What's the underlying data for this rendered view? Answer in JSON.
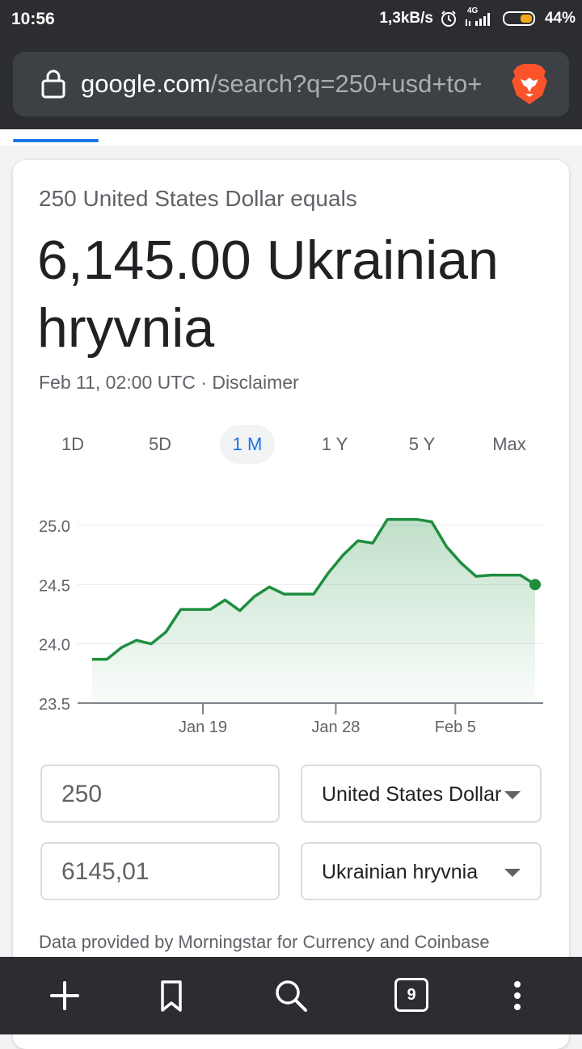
{
  "status_bar": {
    "time": "10:56",
    "network_speed": "1,3kB/s",
    "network_type": "4G",
    "battery": "44%",
    "icons": [
      "alarm-icon",
      "signal-icon",
      "battery-icon"
    ]
  },
  "browser": {
    "url_domain": "google.com",
    "url_path": "/search?q=250+usd+to+",
    "icons": [
      "lock-icon",
      "brave-lion-icon"
    ]
  },
  "converter": {
    "equals_label": "250 United States Dollar equals",
    "result": "6,145.00 Ukrainian hryvnia",
    "timestamp": "Feb 11, 02:00 UTC · Disclaimer",
    "ranges": [
      "1D",
      "5D",
      "1 M",
      "1 Y",
      "5 Y",
      "Max"
    ],
    "active_range": "1 M",
    "from_amount": "250",
    "from_currency": "United States Dollar",
    "to_amount": "6145,01",
    "to_currency": "Ukrainian hryvnia",
    "provider_text": "Data provided by Morningstar for Currency and Coinbase"
  },
  "chart_data": {
    "type": "area",
    "x_ticks": [
      "Jan 19",
      "Jan 28",
      "Feb 5"
    ],
    "y_ticks": [
      "25.0",
      "24.5",
      "24.0",
      "23.5"
    ],
    "ylim": [
      23.5,
      25.0
    ],
    "grid": true,
    "values": [
      23.87,
      23.87,
      23.97,
      24.03,
      24.0,
      24.1,
      24.29,
      24.29,
      24.29,
      24.37,
      24.28,
      24.4,
      24.48,
      24.42,
      24.42,
      24.42,
      24.6,
      24.75,
      24.87,
      24.85,
      25.05,
      25.05,
      25.05,
      25.03,
      24.82,
      24.68,
      24.57,
      24.58,
      24.58,
      24.58,
      24.5
    ],
    "color": "#1e8e3e",
    "fill_color": "#ceead6"
  },
  "bottom_nav": {
    "tab_count": "9",
    "icons": [
      "plus-icon",
      "bookmark-icon",
      "search-icon",
      "tabs-icon",
      "more-vert-icon"
    ]
  }
}
